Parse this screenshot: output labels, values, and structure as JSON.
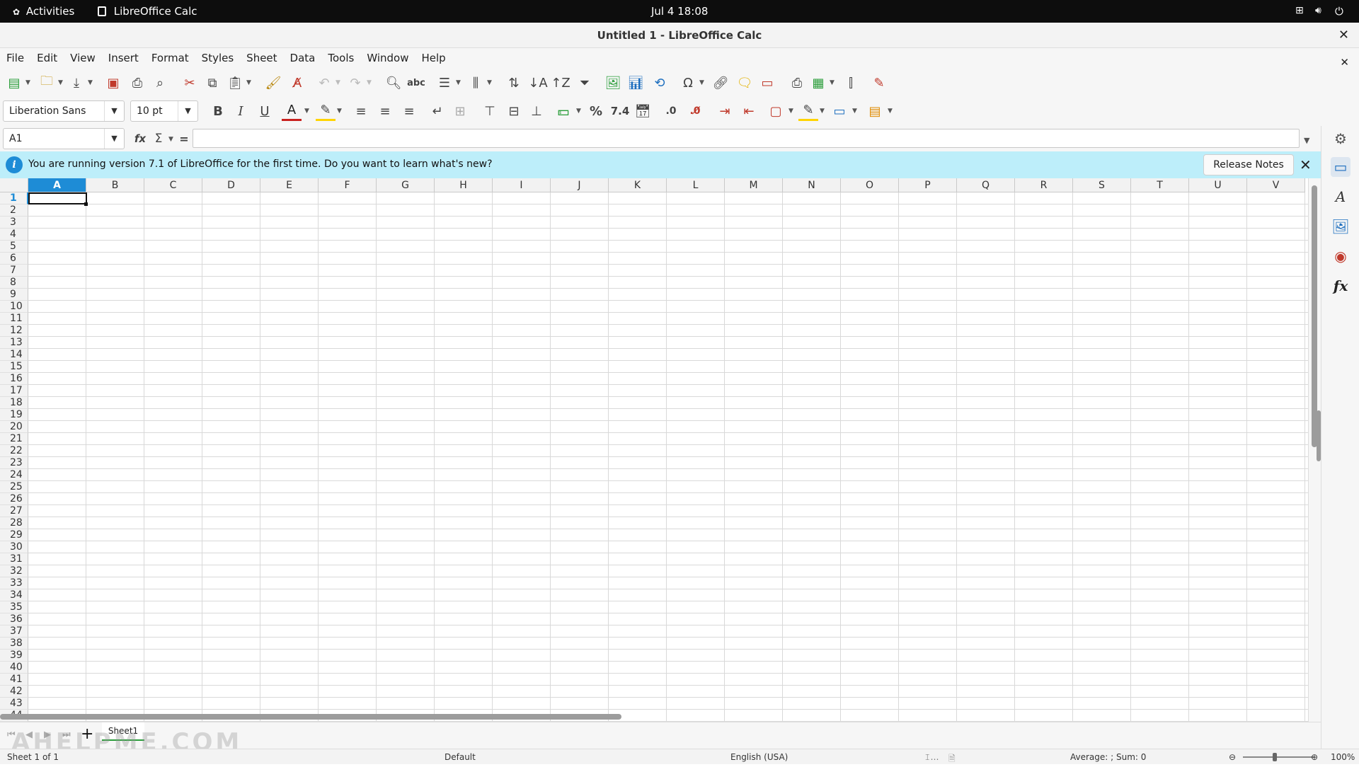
{
  "topbar": {
    "activities": "Activities",
    "app": "LibreOffice Calc",
    "clock": "Jul 4  18:08"
  },
  "window": {
    "title": "Untitled 1 - LibreOffice Calc"
  },
  "menu": [
    "File",
    "Edit",
    "View",
    "Insert",
    "Format",
    "Styles",
    "Sheet",
    "Data",
    "Tools",
    "Window",
    "Help"
  ],
  "format_bar": {
    "font_name": "Liberation Sans",
    "font_size": "10 pt"
  },
  "formula_bar": {
    "name_box": "A1",
    "formula": ""
  },
  "infobar": {
    "message": "You are running version 7.1 of LibreOffice for the first time. Do you want to learn what's new?",
    "button": "Release Notes"
  },
  "grid": {
    "columns": [
      "A",
      "B",
      "C",
      "D",
      "E",
      "F",
      "G",
      "H",
      "I",
      "J",
      "K",
      "L",
      "M",
      "N",
      "O",
      "P",
      "Q",
      "R",
      "S",
      "T",
      "U",
      "V"
    ],
    "rows": 44,
    "selected": "A1"
  },
  "sheet_tabs": {
    "tabs": [
      "Sheet1"
    ],
    "active": "Sheet1"
  },
  "status": {
    "sheet": "Sheet 1 of 1",
    "page_style": "Default",
    "language": "English (USA)",
    "summary": "Average: ; Sum: 0",
    "zoom": "100%"
  },
  "watermark": "AHELPME.COM",
  "colors": {
    "accent": "#1e8cd6",
    "infobar": "#bdeefa",
    "selected_header": "#1e8cd6"
  }
}
